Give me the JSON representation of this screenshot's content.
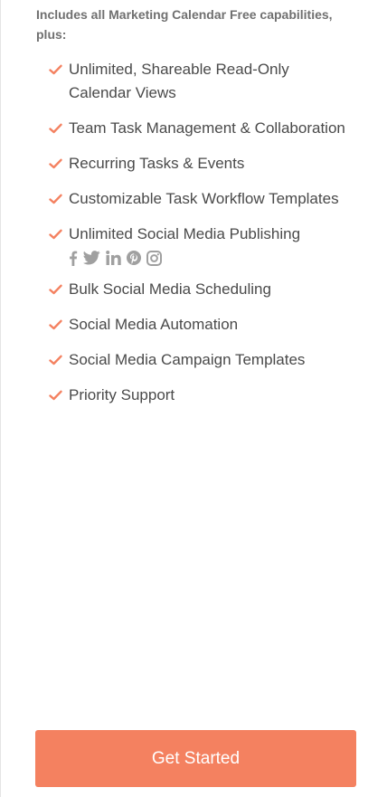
{
  "plan": {
    "intro_text": "Includes all Marketing Calendar Free capabilities, plus:",
    "features": [
      {
        "label": "Unlimited, Shareable Read-Only Calendar Views"
      },
      {
        "label": "Team Task Management & Collaboration"
      },
      {
        "label": "Recurring Tasks & Events"
      },
      {
        "label": "Customizable Task Workflow Templates"
      },
      {
        "label": "Unlimited Social Media Publishing"
      },
      {
        "label": "Bulk Social Media Scheduling"
      },
      {
        "label": "Social Media Automation"
      },
      {
        "label": "Social Media Campaign Templates"
      },
      {
        "label": "Priority Support"
      }
    ],
    "social_icons": [
      "facebook-icon",
      "twitter-icon",
      "linkedin-icon",
      "pinterest-icon",
      "instagram-icon"
    ],
    "cta_label": "Get Started"
  },
  "colors": {
    "accent": "#f48160",
    "text": "#4a4a4a",
    "muted_text": "#707070",
    "icon_gray": "#a0a0a0"
  }
}
